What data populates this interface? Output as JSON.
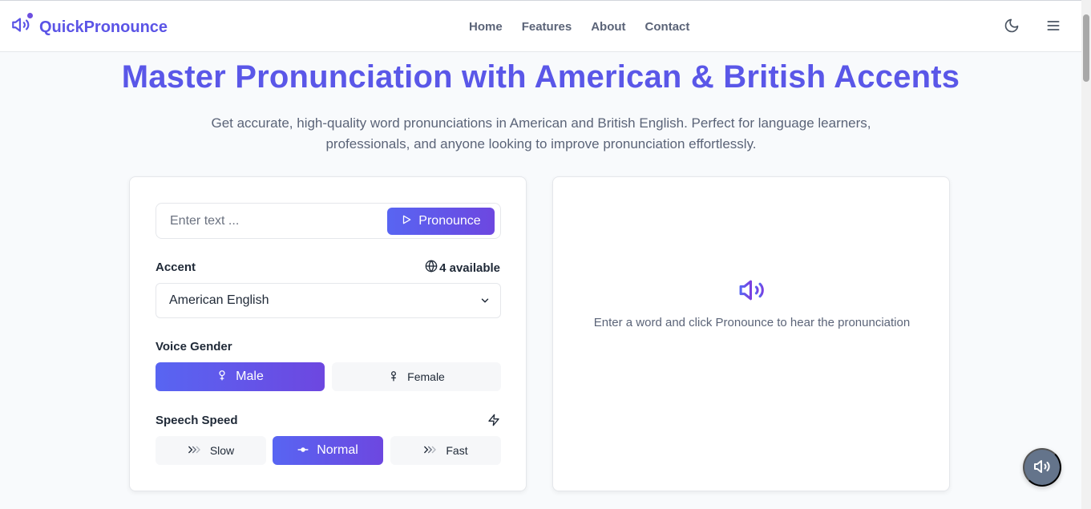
{
  "brand": {
    "name": "QuickPronounce",
    "icon": "speaker-icon",
    "accent": "#5b54e6"
  },
  "nav": {
    "items": [
      "Home",
      "Features",
      "About",
      "Contact"
    ]
  },
  "header_actions": {
    "theme_icon": "moon-icon",
    "menu_icon": "menu-icon"
  },
  "hero": {
    "title": "Master Pronunciation with American & British Accents",
    "subtitle": "Get accurate, high-quality word pronunciations in American and British English. Perfect for language learners, professionals, and anyone looking to improve pronunciation effortlessly."
  },
  "form": {
    "input": {
      "placeholder": "Enter text ...",
      "value": ""
    },
    "pronounce_label": "Pronounce",
    "accent": {
      "label": "Accent",
      "available": "4 available",
      "selected": "American English"
    },
    "gender": {
      "label": "Voice Gender",
      "options": [
        "Male",
        "Female"
      ],
      "selected": "Male"
    },
    "speed": {
      "label": "Speech Speed",
      "options": [
        "Slow",
        "Normal",
        "Fast"
      ],
      "selected": "Normal"
    }
  },
  "result": {
    "empty_text": "Enter a word and click Pronounce to hear the pronunciation",
    "icon": "speaker-icon"
  },
  "fab": {
    "icon": "speaker-icon"
  },
  "colors": {
    "gradient_start": "#5865f2",
    "gradient_end": "#6d47e0",
    "title": "#5a57e8",
    "fab": "#64748b"
  }
}
